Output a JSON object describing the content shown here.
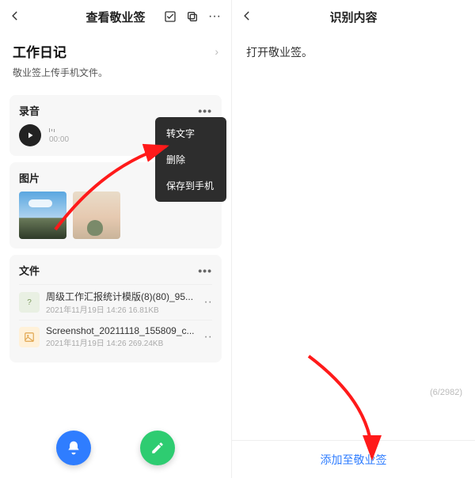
{
  "left": {
    "header": {
      "title": "查看敬业签"
    },
    "note": {
      "title": "工作日记",
      "subtitle": "敬业签上传手机文件。"
    },
    "audio": {
      "section_label": "录音",
      "time": "00:00"
    },
    "popup": {
      "items": [
        "转文字",
        "删除",
        "保存到手机"
      ]
    },
    "images": {
      "section_label": "图片"
    },
    "files": {
      "section_label": "文件",
      "rows": [
        {
          "name": "周级工作汇报统计模版(8)(80)_95...",
          "meta": "2021年11月19日  14:26  16.81KB"
        },
        {
          "name": "Screenshot_20211118_155809_c...",
          "meta": "2021年11月19日  14:26  269.24KB"
        }
      ]
    }
  },
  "right": {
    "header": {
      "title": "识别内容"
    },
    "body_text": "打开敬业签。",
    "char_count": "(6/2982)",
    "footer_button": "添加至敬业签"
  }
}
